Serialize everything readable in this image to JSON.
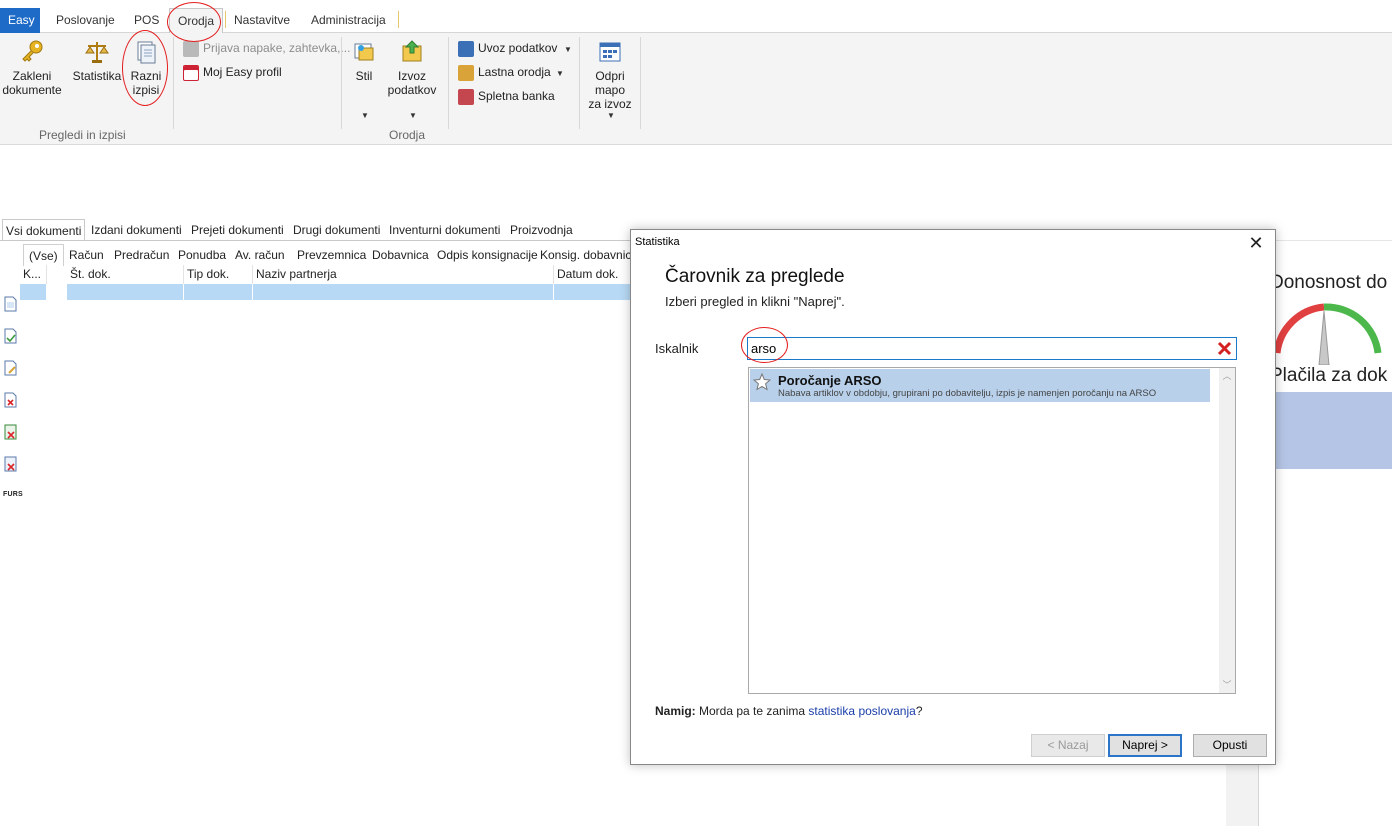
{
  "ribbon": {
    "tabs": [
      "Easy",
      "Poslovanje",
      "POS",
      "Orodja",
      "Nastavitve",
      "Administracija"
    ],
    "groups": {
      "pregledi_label": "Pregledi in izpisi",
      "orodja_label": "Orodja"
    },
    "buttons": {
      "zakleni": "Zakleni dokumente",
      "zakleni_l1": "Zakleni",
      "zakleni_l2": "dokumente",
      "statistika": "Statistika",
      "razni_l1": "Razni",
      "razni_l2": "izpisi",
      "prijava": "Prijava napake, zahtevka,...",
      "moj_profil": "Moj Easy profil",
      "stil": "Stil",
      "izvoz_l1": "Izvoz",
      "izvoz_l2": "podatkov",
      "uvoz": "Uvoz podatkov",
      "lastna": "Lastna orodja",
      "spletna": "Spletna banka",
      "odpri_l1": "Odpri",
      "odpri_l2": "mapo",
      "odpri_l3": "za izvoz"
    }
  },
  "doc_tabs": [
    "Vsi dokumenti",
    "Izdani dokumenti",
    "Prejeti dokumenti",
    "Drugi dokumenti",
    "Inventurni dokumenti",
    "Proizvodnja"
  ],
  "filter_tabs": [
    "(Vse)",
    "Račun",
    "Predračun",
    "Ponudba",
    "Av. račun",
    "Prevzemnica",
    "Dobavnica",
    "Odpis konsignacije",
    "Konsig. dobavnica"
  ],
  "grid_columns": [
    "K...",
    "Št. dok.",
    "Tip dok.",
    "Naziv partnerja",
    "Datum dok."
  ],
  "side_labels": {
    "furs": "FURS"
  },
  "background_panel": {
    "title1": "Donosnost do",
    "title2": "Plačila za dok"
  },
  "dialog": {
    "title": "Statistika",
    "heading": "Čarovnik za preglede",
    "subtitle": "Izberi pregled in klikni \"Naprej\".",
    "search_label": "Iskalnik",
    "search_value": "arso",
    "results": [
      {
        "title": "Poročanje ARSO",
        "description": "Nabava artiklov v obdobju, grupirani po dobavitelju, izpis je namenjen poročanju na ARSO"
      }
    ],
    "hint_label": "Namig:",
    "hint_text": "Morda pa te zanima",
    "hint_link": "statistika poslovanja",
    "hint_end": "?",
    "buttons": {
      "back": "< Nazaj",
      "next": "Naprej >",
      "cancel": "Opusti"
    }
  },
  "colors": {
    "accent": "#1e6bc7",
    "selection": "#b8d0ea",
    "annotation": "#e31e1e"
  }
}
